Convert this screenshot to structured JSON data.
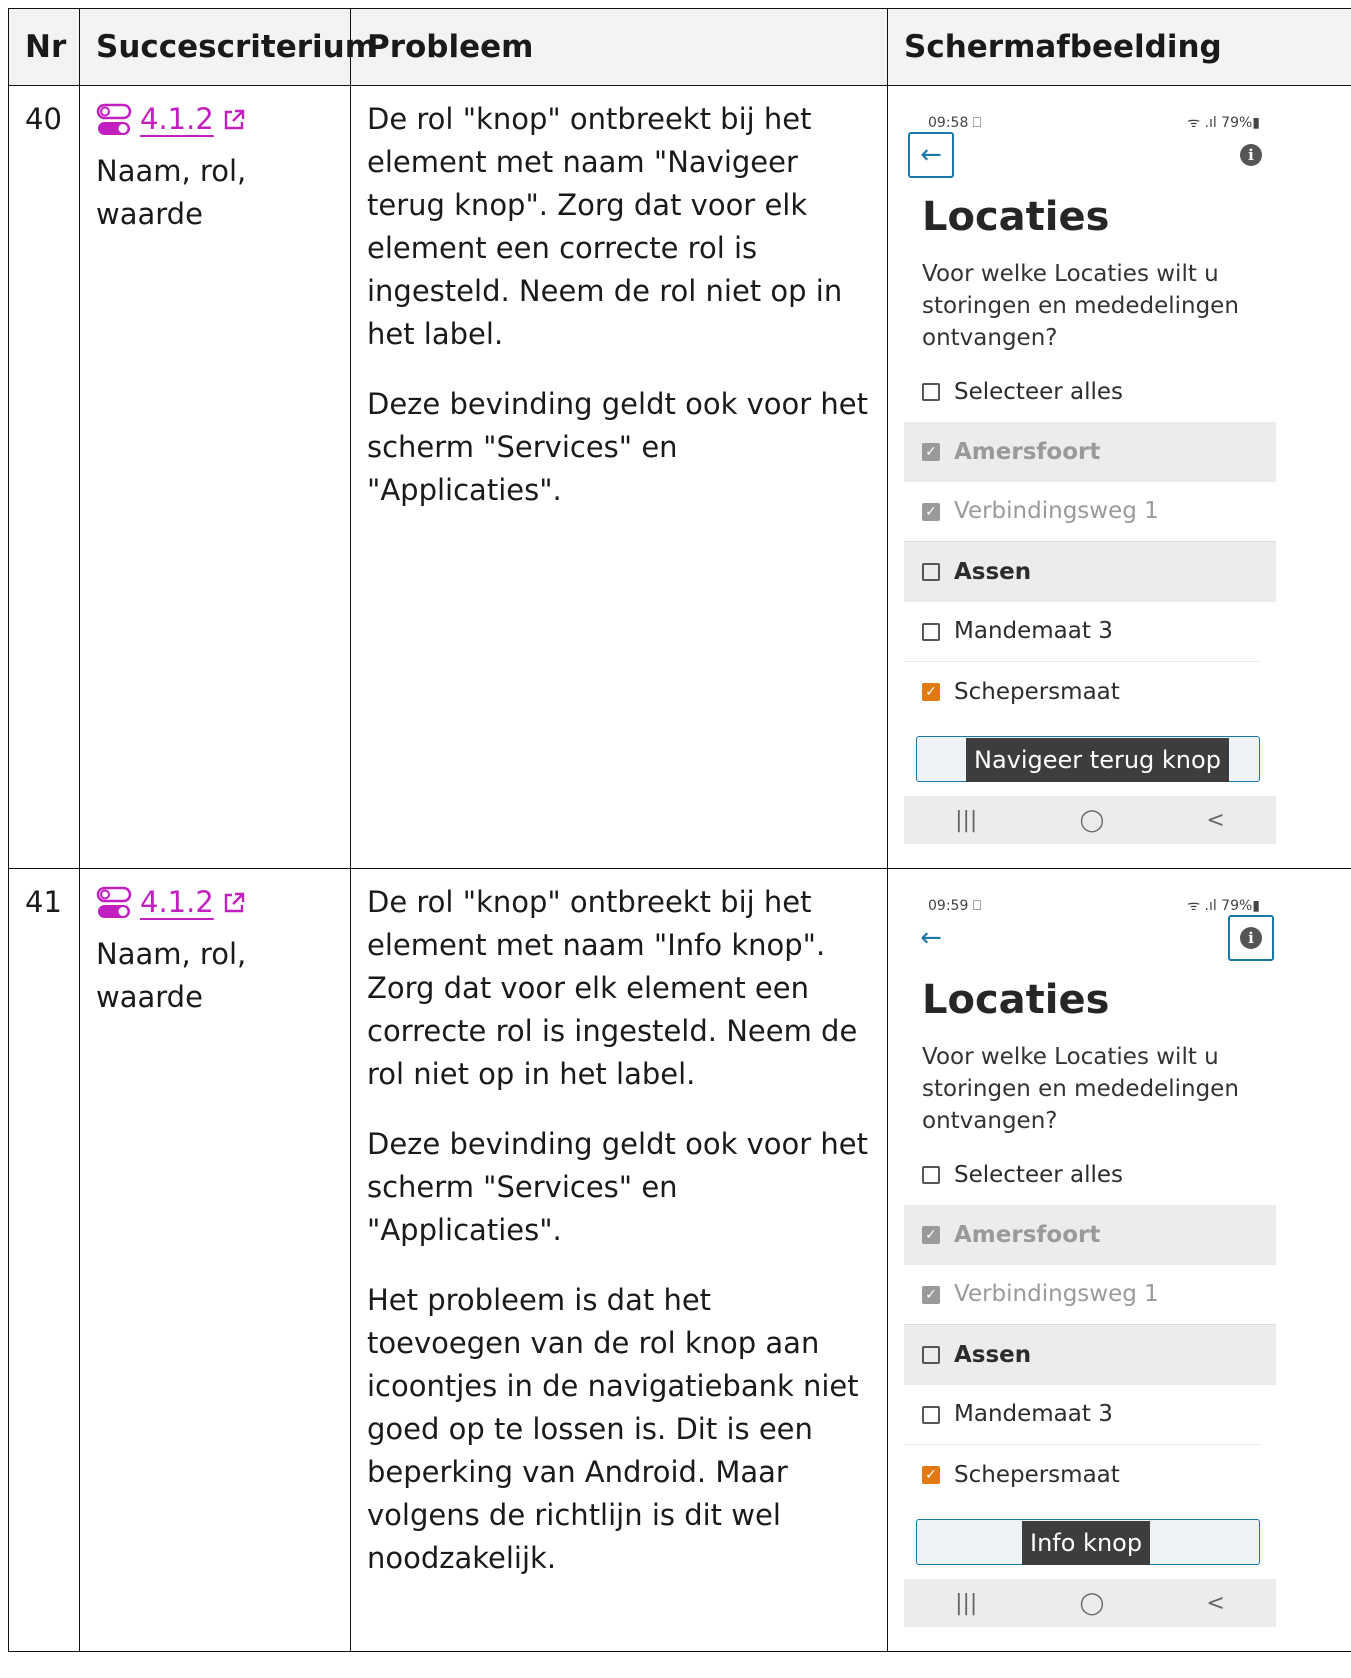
{
  "headers": {
    "nr": "Nr",
    "criterion": "Succescriterium",
    "problem": "Probleem",
    "screenshot": "Schermafbeelding"
  },
  "rows": [
    {
      "nr": "40",
      "criterion_link": "4.1.2",
      "criterion_name": "Naam, rol, waarde",
      "problem": [
        "De rol \"knop\" ontbreekt bij het element met naam \"Navigeer terug knop\". Zorg dat voor elk element een correcte rol is ingesteld. Neem de rol niet op in het label.",
        "Deze bevinding geldt ook voor het scherm \"Services\" en \"Applicaties\"."
      ],
      "phone": {
        "time": "09:58 ⎕",
        "status_right": "ᯤ .ıl 79%▮",
        "back_icon": "←",
        "info_icon": "i",
        "title": "Locaties",
        "description": "Voor welke Locaties wilt u storingen en mededelingen ontvangen?",
        "select_all": "Selecteer alles",
        "group1": "Amersfoort",
        "item1": "Verbindingsweg 1",
        "group2": "Assen",
        "item2": "Mandemaat 3",
        "item3": "Schepersmaat",
        "tooltip": "Navigeer terug knop",
        "focused": "back",
        "nav": [
          "|||",
          "◯",
          "<"
        ]
      }
    },
    {
      "nr": "41",
      "criterion_link": "4.1.2",
      "criterion_name": "Naam, rol, waarde",
      "problem": [
        "De rol \"knop\" ontbreekt bij het element met naam \"Info knop\". Zorg dat voor elk element een correcte rol is ingesteld. Neem de rol niet op in het label.",
        "Deze bevinding geldt ook voor het scherm \"Services\" en \"Applicaties\".",
        "Het probleem is dat het toevoegen van de rol knop aan icoontjes in de navigatiebank niet goed op te lossen is. Dit is een beperking van Android. Maar volgens de richtlijn is dit wel noodzakelijk."
      ],
      "phone": {
        "time": "09:59 ⎕",
        "status_right": "ᯤ .ıl 79%▮",
        "back_icon": "←",
        "info_icon": "i",
        "title": "Locaties",
        "description": "Voor welke Locaties wilt u storingen en mededelingen ontvangen?",
        "select_all": "Selecteer alles",
        "group1": "Amersfoort",
        "item1": "Verbindingsweg 1",
        "group2": "Assen",
        "item2": "Mandemaat 3",
        "item3": "Schepersmaat",
        "tooltip": "Info knop",
        "focused": "info",
        "nav": [
          "|||",
          "◯",
          "<"
        ]
      }
    }
  ],
  "colors": {
    "link": "#c21fc0",
    "focus": "#1a78a8",
    "checked_accent": "#e07a10"
  }
}
